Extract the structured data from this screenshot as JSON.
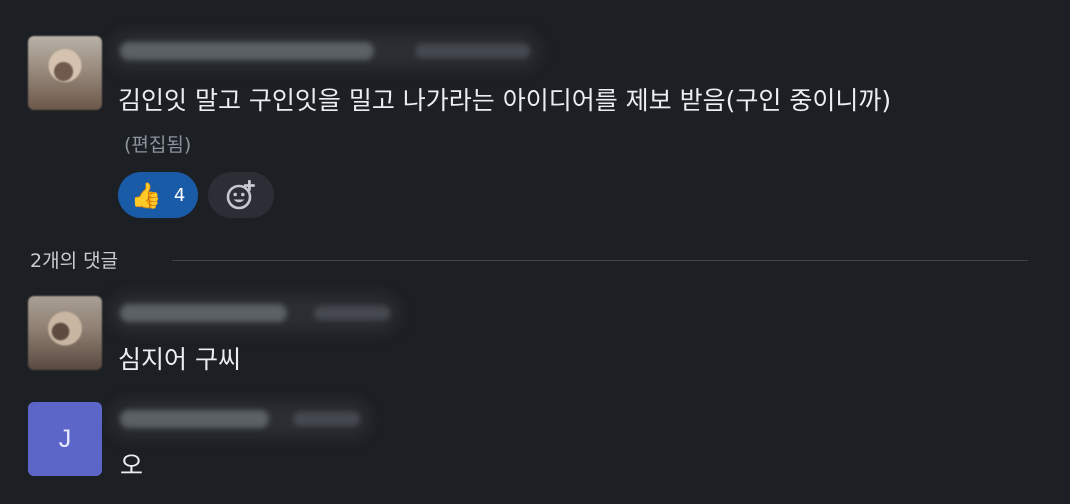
{
  "main_comment": {
    "text": "김인잇 말고 구인잇을 밀고 나가라는 아이디어를 제보 받음(구인 중이니까)",
    "edited_label": "(편집됨)",
    "reactions": {
      "like_icon": "👍",
      "like_count": "4",
      "add_reaction_icon": "add-emoji-icon"
    }
  },
  "replies": {
    "header": "2개의 댓글",
    "items": [
      {
        "text": "심지어 구씨",
        "avatar_type": "photo"
      },
      {
        "text": "오",
        "avatar_type": "letter",
        "avatar_letter": "J",
        "avatar_color": "#5c66c9"
      }
    ]
  },
  "colors": {
    "background": "#1c1f24",
    "like_reaction": "#1a5ba8",
    "reaction_pill": "#2b2f35"
  }
}
